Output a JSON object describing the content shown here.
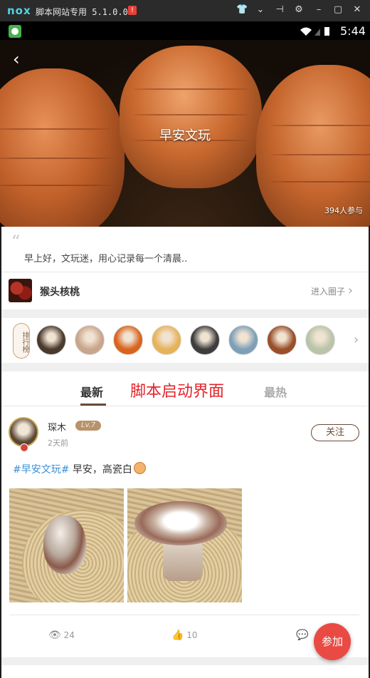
{
  "emulator": {
    "logo": "nox",
    "title": "脚本网站专用 5.1.0.0",
    "badge": "!",
    "icons": [
      "shirt-icon",
      "chevron-down-icon",
      "pin-icon",
      "gear-icon",
      "minimize-icon",
      "maximize-icon",
      "close-icon"
    ],
    "icon_glyphs": [
      "👕",
      "⌄",
      "⊣",
      "⚙",
      "–",
      "▢",
      "✕"
    ]
  },
  "status_bar": {
    "time": "5:44"
  },
  "hero": {
    "title": "早安文玩",
    "participants": "394人参与",
    "back": "‹"
  },
  "description": {
    "quote": "“",
    "text": "早上好，文玩迷，用心记录每一个清晨.."
  },
  "circle": {
    "name": "猴头核桃",
    "enter_label": "进入圈子",
    "chevron": "›"
  },
  "ranking": {
    "badge_label": "排行榜",
    "chevron": "›",
    "avatar_colors": [
      "#4a3a2e",
      "#c9a58c",
      "#d8641f",
      "#e6b35a",
      "#3d3d3d",
      "#7da0b8",
      "#9a4f2a",
      "#b9c4a8"
    ]
  },
  "tabs": {
    "latest": "最新",
    "hot": "最热",
    "overlay": "脚本启动界面"
  },
  "post": {
    "author": "琛木",
    "level": "Lv.7",
    "time": "2天前",
    "follow_label": "关注",
    "hashtag": "#早安文玩#",
    "text": " 早安，高瓷白",
    "views": "24",
    "likes": "10"
  },
  "fab": {
    "label": "参加"
  }
}
